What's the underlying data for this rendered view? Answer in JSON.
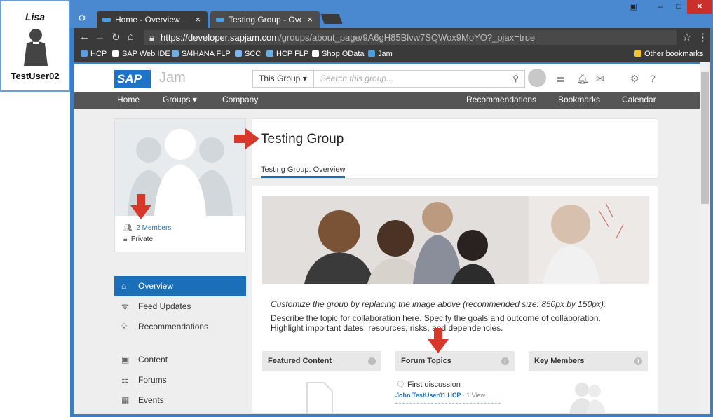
{
  "user": {
    "name": "Lisa",
    "username": "TestUser02"
  },
  "browser": {
    "tabs": [
      {
        "label": "Home - Overview"
      },
      {
        "label": "Testing Group - Overview"
      }
    ],
    "url": {
      "host": "https://developer.sapjam.com",
      "path": "/groups/about_page/9A6gH85Blvw7SQWox9MoYO?_pjax=true"
    },
    "bookmarks": [
      "HCP",
      "SAP Web IDE",
      "S/4HANA FLP",
      "SCC",
      "HCP FLP",
      "Shop OData",
      "Jam"
    ],
    "other_bookmarks": "Other bookmarks"
  },
  "jam": {
    "logo": "SAP",
    "product": "Jam",
    "group_select": "This Group",
    "search_placeholder": "Search this group...",
    "nav_left": [
      "Home",
      "Groups",
      "Company"
    ],
    "nav_right": [
      "Recommendations",
      "Bookmarks",
      "Calendar"
    ]
  },
  "group": {
    "members": "2 Members",
    "privacy": "Private",
    "title": "Testing Group",
    "subtab": "Testing Group: Overview",
    "left_nav": [
      {
        "label": "Overview",
        "icon": "home-icon",
        "active": true
      },
      {
        "label": "Feed Updates",
        "icon": "feed-icon"
      },
      {
        "label": "Recommendations",
        "icon": "lightbulb-icon"
      },
      {
        "label": "Content",
        "icon": "content-icon"
      },
      {
        "label": "Forums",
        "icon": "forums-icon"
      },
      {
        "label": "Events",
        "icon": "events-icon"
      }
    ],
    "desc_italic": "Customize the group by replacing the image above (recommended size: 850px by 150px).",
    "desc_text": "Describe the topic for collaboration here. Specify the goals and outcome of collaboration. Highlight important dates, resources, risks, and dependencies.",
    "widgets": [
      "Featured Content",
      "Forum Topics",
      "Key Members"
    ],
    "forum_item": {
      "title": "First discussion",
      "author": "John TestUser01 HCP",
      "views": "1 View"
    }
  },
  "colors": {
    "accent": "#1a6fb8",
    "arrow": "#d8382a",
    "window": "#4a88cf"
  }
}
